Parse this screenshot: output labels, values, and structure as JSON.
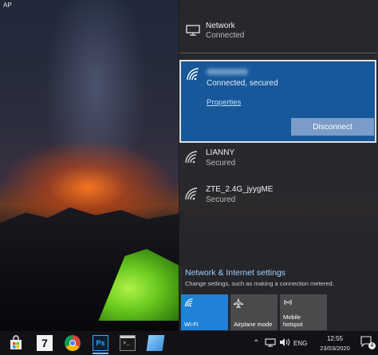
{
  "desktop": {
    "corner_label": "AP"
  },
  "network_header": {
    "title": "Network",
    "status": "Connected",
    "icon": "ethernet-pc-icon"
  },
  "selected_network": {
    "status": "Connected, secured",
    "properties_label": "Properties",
    "disconnect_label": "Disconnect",
    "icon": "wifi-icon"
  },
  "networks": [
    {
      "name": "LIANNY",
      "status": "Secured",
      "icon": "wifi-secured-icon"
    },
    {
      "name": "ZTE_2.4G_jyygME",
      "status": "Secured",
      "icon": "wifi-secured-icon"
    }
  ],
  "settings": {
    "link": "Network & Internet settings",
    "description": "Change settings, such as making a connection metered."
  },
  "quick_actions": [
    {
      "label": "Wi-Fi",
      "icon": "wifi-icon",
      "active": true
    },
    {
      "label": "Airplane mode",
      "icon": "airplane-icon",
      "active": false
    },
    {
      "label_line1": "Mobile",
      "label_line2": "hotspot",
      "icon": "hotspot-icon",
      "active": false
    }
  ],
  "taskbar": {
    "apps": [
      {
        "name": "store",
        "icon": "store-icon"
      },
      {
        "name": "seven",
        "text": "7"
      },
      {
        "name": "chrome",
        "icon": "chrome-icon"
      },
      {
        "name": "photoshop",
        "text": "Ps"
      },
      {
        "name": "command-prompt",
        "icon": "terminal-icon"
      },
      {
        "name": "notes",
        "icon": "notes-icon"
      }
    ],
    "tray": {
      "language": "ENG",
      "time": "12:55",
      "date": "23/03/2020",
      "notification_count": "4"
    }
  },
  "colors": {
    "accent": "#1f82d6",
    "selected_bg": "#17589a",
    "flyout_bg": "#28282c",
    "link": "#9ed2ff",
    "taskbar": "#121216"
  }
}
